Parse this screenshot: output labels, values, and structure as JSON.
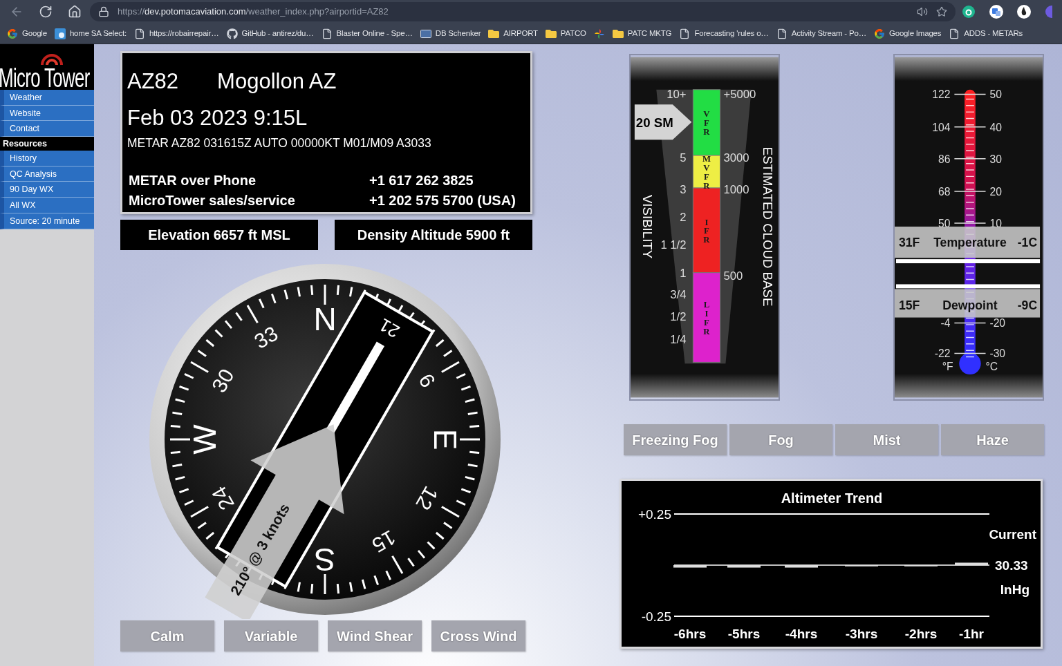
{
  "browser": {
    "url": {
      "scheme": "https://",
      "host": "dev.potomacaviation.com",
      "path": "/weather_index.php?airportid=AZ82"
    },
    "bookmarks": [
      {
        "kind": "google",
        "label": "Google"
      },
      {
        "kind": "app",
        "label": "home SA Select:"
      },
      {
        "kind": "page",
        "label": "https://robairrepair…"
      },
      {
        "kind": "github",
        "label": "GitHub - antirez/du…"
      },
      {
        "kind": "page",
        "label": "Blaster Online - Spe…"
      },
      {
        "kind": "db",
        "label": "DB Schenker"
      },
      {
        "kind": "folder",
        "label": "AIRPORT"
      },
      {
        "kind": "folder",
        "label": "PATCO"
      },
      {
        "kind": "pinwheel"
      },
      {
        "kind": "folder",
        "label": "PATC MKTG"
      },
      {
        "kind": "page",
        "label": "Forecasting 'rules o…"
      },
      {
        "kind": "page",
        "label": "Activity Stream - Po…"
      },
      {
        "kind": "google",
        "label": "Google Images"
      },
      {
        "kind": "page",
        "label": "ADDS - METARs"
      }
    ]
  },
  "sidebar": {
    "logo": "Micro Tower",
    "items": [
      {
        "kind": "link",
        "label": "Weather"
      },
      {
        "kind": "link",
        "label": "Website"
      },
      {
        "kind": "link",
        "label": "Contact"
      },
      {
        "kind": "header",
        "label": "Resources"
      },
      {
        "kind": "link",
        "label": "History"
      },
      {
        "kind": "link",
        "label": "QC Analysis"
      },
      {
        "kind": "link",
        "label": "90 Day WX"
      },
      {
        "kind": "link",
        "label": "All WX"
      },
      {
        "kind": "link",
        "label": "Source: 20 minute"
      }
    ]
  },
  "station": {
    "id": "AZ82",
    "name": "Mogollon AZ",
    "time": "Feb 03 2023 9:15L",
    "metar": "METAR AZ82 031615Z AUTO 00000KT M01/M09 A3033",
    "contacts": [
      {
        "label": "METAR over Phone",
        "phone": "+1 617 262 3825"
      },
      {
        "label": "MicroTower sales/service",
        "phone": "+1 202 575 5700 (USA)"
      }
    ]
  },
  "elevation": "Elevation 6657 ft MSL",
  "density_altitude": "Density Altitude 5900 ft",
  "compass": {
    "labels": [
      {
        "kind": "cardinal",
        "label": "N"
      },
      {
        "kind": "number",
        "label": "6"
      },
      {
        "kind": "cardinal",
        "label": "E"
      },
      {
        "kind": "number",
        "label": "12"
      },
      {
        "kind": "number",
        "label": "15"
      },
      {
        "kind": "cardinal",
        "label": "S"
      },
      {
        "kind": "number",
        "label": "24"
      },
      {
        "kind": "cardinal",
        "label": "W"
      },
      {
        "kind": "number",
        "label": "30"
      },
      {
        "kind": "number",
        "label": "33"
      }
    ],
    "runway": "21",
    "wind": "210° @ 3 knots"
  },
  "wind_flags": [
    {
      "label": "Calm",
      "on": false
    },
    {
      "label": "Variable",
      "on": false
    },
    {
      "label": "Wind Shear",
      "on": false
    },
    {
      "label": "Cross Wind",
      "on": false
    }
  ],
  "visibility": {
    "title": "VISIBILITY",
    "cloud_title": "ESTIMATED CLOUD BASE",
    "reading": "20 SM",
    "scale": [
      "10+",
      "5",
      "3",
      "2",
      "1 1/2",
      "1",
      "3/4",
      "1/2",
      "1/4"
    ],
    "cloud_scale": [
      "+5000",
      "3000",
      "1000",
      "500"
    ],
    "categories": [
      {
        "label": "VFR",
        "color": "#22dd44"
      },
      {
        "label": "MVFR",
        "color": "#eeee44"
      },
      {
        "label": "IFR",
        "color": "#ee2222"
      },
      {
        "label": "LIFR",
        "color": "#dd22cc"
      }
    ]
  },
  "thermometer": {
    "f_scale": [
      "122",
      "104",
      "86",
      "68",
      "50",
      "-4",
      "-22"
    ],
    "c_scale": [
      "50",
      "40",
      "30",
      "20",
      "10",
      "-20",
      "-30"
    ],
    "f_unit": "°F",
    "c_unit": "°C",
    "readings": [
      {
        "f": "31F",
        "name": "Temperature",
        "c": "-1C"
      },
      {
        "f": "15F",
        "name": "Dewpoint",
        "c": "-9C"
      }
    ]
  },
  "weather_flags": [
    {
      "label": "Freezing Fog",
      "on": false
    },
    {
      "label": "Fog",
      "on": false
    },
    {
      "label": "Mist",
      "on": false
    },
    {
      "label": "Haze",
      "on": false
    }
  ],
  "altimeter": {
    "chart_data": {
      "type": "bar",
      "title": "Altimeter Trend",
      "categories": [
        "-6hrs",
        "-5hrs",
        "-4hrs",
        "-3hrs",
        "-2hrs",
        "-1hr"
      ],
      "values": [
        -0.012,
        -0.012,
        -0.012,
        -0.006,
        -0.006,
        0.012
      ],
      "ylim": [
        -0.25,
        0.25
      ],
      "yticks": [
        {
          "value": -0.25,
          "label": "-0.25"
        },
        {
          "value": 0.25,
          "label": "+0.25"
        }
      ]
    },
    "current_label": "Current",
    "current": "30.33",
    "unit": "InHg"
  }
}
